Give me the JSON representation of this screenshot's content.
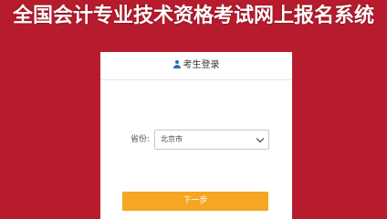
{
  "page": {
    "title": "全国会计专业技术资格考试网上报名系统"
  },
  "login": {
    "heading": "考生登录",
    "heading_icon": "user-icon",
    "province_label": "省份:",
    "province_value": "北京市",
    "next_label": "下一步"
  },
  "colors": {
    "background": "#b71c2e",
    "button": "#f5a623",
    "icon": "#2d6db5"
  }
}
